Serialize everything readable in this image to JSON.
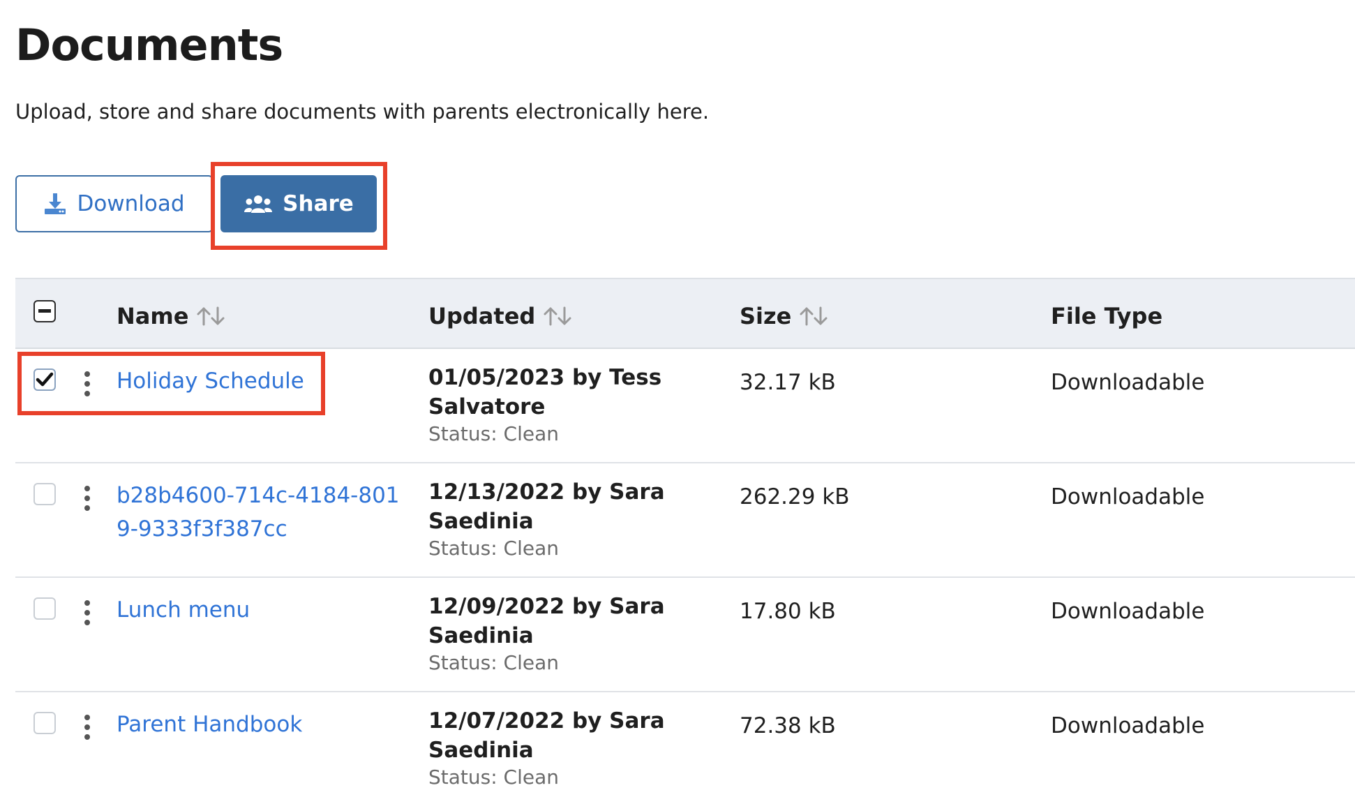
{
  "header": {
    "title": "Documents",
    "description": "Upload, store and share documents with parents electronically here."
  },
  "toolbar": {
    "download_label": "Download",
    "share_label": "Share"
  },
  "table": {
    "columns": {
      "name": "Name",
      "updated": "Updated",
      "size": "Size",
      "file_type": "File Type"
    },
    "rows": [
      {
        "name": "Holiday Schedule",
        "updated_by": "01/05/2023 by Tess Salvatore",
        "status": "Status: Clean",
        "size": "32.17 kB",
        "file_type": "Downloadable",
        "checked": true
      },
      {
        "name": "b28b4600-714c-4184-8019-9333f3f387cc",
        "updated_by": "12/13/2022 by Sara Saedinia",
        "status": "Status: Clean",
        "size": "262.29 kB",
        "file_type": "Downloadable",
        "checked": false
      },
      {
        "name": "Lunch menu",
        "updated_by": "12/09/2022 by Sara Saedinia",
        "status": "Status: Clean",
        "size": "17.80 kB",
        "file_type": "Downloadable",
        "checked": false
      },
      {
        "name": "Parent Handbook",
        "updated_by": "12/07/2022 by Sara Saedinia",
        "status": "Status: Clean",
        "size": "72.38 kB",
        "file_type": "Downloadable",
        "checked": false
      }
    ]
  },
  "colors": {
    "accent": "#3a6ea5",
    "link": "#2f73d6",
    "highlight": "#e8402a",
    "header_bg": "#eceff4"
  },
  "icons": {
    "download": "download-icon",
    "share": "users-icon",
    "sort": "sort-arrows-icon",
    "row_menu": "kebab-menu-icon"
  }
}
